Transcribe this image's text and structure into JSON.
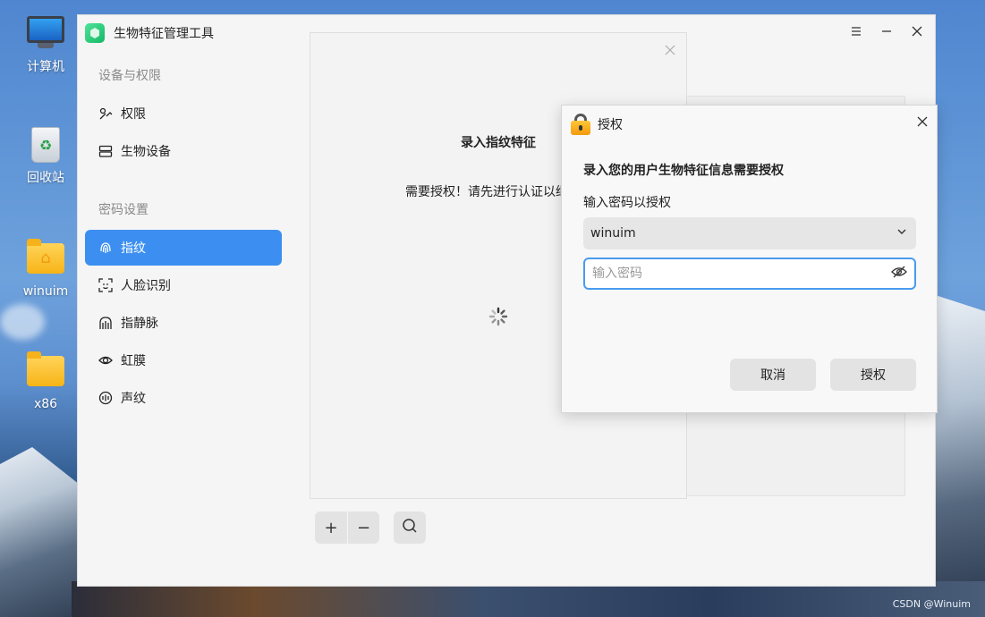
{
  "desktop": {
    "icons": [
      {
        "label": "计算机",
        "icon": "computer-icon"
      },
      {
        "label": "回收站",
        "icon": "trash-icon"
      },
      {
        "label": "winuim",
        "icon": "home-folder-icon"
      },
      {
        "label": "x86",
        "icon": "folder-icon"
      }
    ],
    "watermark": "CSDN @Winuim"
  },
  "window": {
    "title": "生物特征管理工具",
    "controls": [
      "menu-icon",
      "minimize-icon",
      "close-icon"
    ]
  },
  "sidebar": {
    "section1": "设备与权限",
    "items1": [
      {
        "label": "权限",
        "icon": "permission-icon"
      },
      {
        "label": "生物设备",
        "icon": "device-icon"
      }
    ],
    "section2": "密码设置",
    "items2": [
      {
        "label": "指纹",
        "icon": "fingerprint-icon",
        "active": true
      },
      {
        "label": "人脸识别",
        "icon": "face-icon"
      },
      {
        "label": "指静脉",
        "icon": "finger-vein-icon"
      },
      {
        "label": "虹膜",
        "icon": "iris-icon"
      },
      {
        "label": "声纹",
        "icon": "voiceprint-icon"
      }
    ]
  },
  "enroll": {
    "title": "录入指纹特征",
    "description": "需要授权！请先进行认证以继续"
  },
  "toolbar": {
    "add": "+",
    "remove": "−",
    "search": "search-icon"
  },
  "auth": {
    "title": "授权",
    "message": "录入您的用户生物特征信息需要授权",
    "prompt": "输入密码以授权",
    "user": "winuim",
    "password_placeholder": "输入密码",
    "cancel": "取消",
    "confirm": "授权"
  },
  "colors": {
    "accent": "#3c8ff0",
    "focus_border": "#4a9bf0"
  }
}
